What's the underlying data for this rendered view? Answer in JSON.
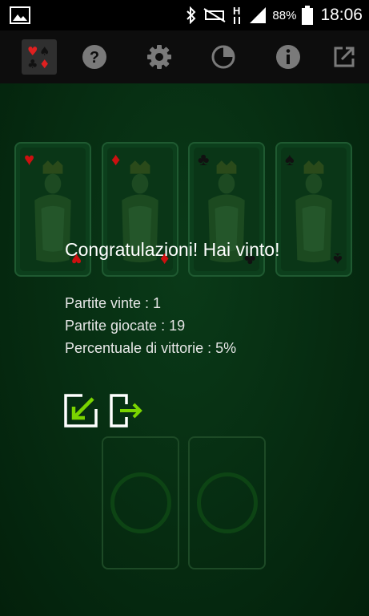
{
  "status_bar": {
    "battery_percent": "88%",
    "clock": "18:06",
    "network_type": "H",
    "icons": [
      "gallery-icon",
      "bluetooth-icon",
      "mute-icon",
      "network-h-icon",
      "signal-icon",
      "battery-icon"
    ]
  },
  "toolbar": {
    "items": [
      {
        "name": "games-icon",
        "selected": true
      },
      {
        "name": "help-icon"
      },
      {
        "name": "settings-icon"
      },
      {
        "name": "statistics-icon"
      },
      {
        "name": "info-icon"
      },
      {
        "name": "open-external-icon"
      }
    ]
  },
  "game": {
    "kings": [
      {
        "suit": "♥",
        "color": "#cc1010"
      },
      {
        "suit": "♦",
        "color": "#cc1010"
      },
      {
        "suit": "♣",
        "color": "#111111"
      },
      {
        "suit": "♠",
        "color": "#111111"
      }
    ],
    "message": "Congratulazioni! Hai vinto!",
    "stats": {
      "won": "Partite vinte  : 1",
      "played": "Partite giocate  : 19",
      "percent": "Percentuale di vittorie  : 5%"
    },
    "colors": {
      "felt": "#062c11",
      "accent_green": "#7ad400"
    }
  }
}
